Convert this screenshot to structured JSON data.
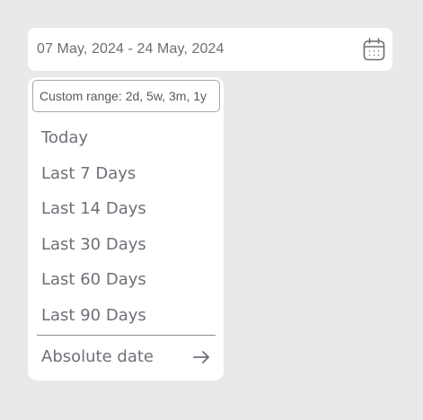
{
  "date_range": {
    "value": "07 May, 2024 - 24 May, 2024",
    "icon": "calendar-icon"
  },
  "dropdown": {
    "custom_input_placeholder": "Custom range: 2d, 5w, 3m, 1y",
    "custom_input_value": "",
    "options": [
      {
        "label": "Today"
      },
      {
        "label": "Last 7 Days"
      },
      {
        "label": "Last 14 Days"
      },
      {
        "label": "Last 30 Days"
      },
      {
        "label": "Last 60 Days"
      },
      {
        "label": "Last 90 Days"
      }
    ],
    "absolute_date_label": "Absolute date",
    "absolute_date_icon": "arrow-right-icon"
  },
  "colors": {
    "page_background": "#e9e9e9",
    "surface": "#ffffff",
    "text": "#6f6f78",
    "border": "#a8a8a8"
  }
}
